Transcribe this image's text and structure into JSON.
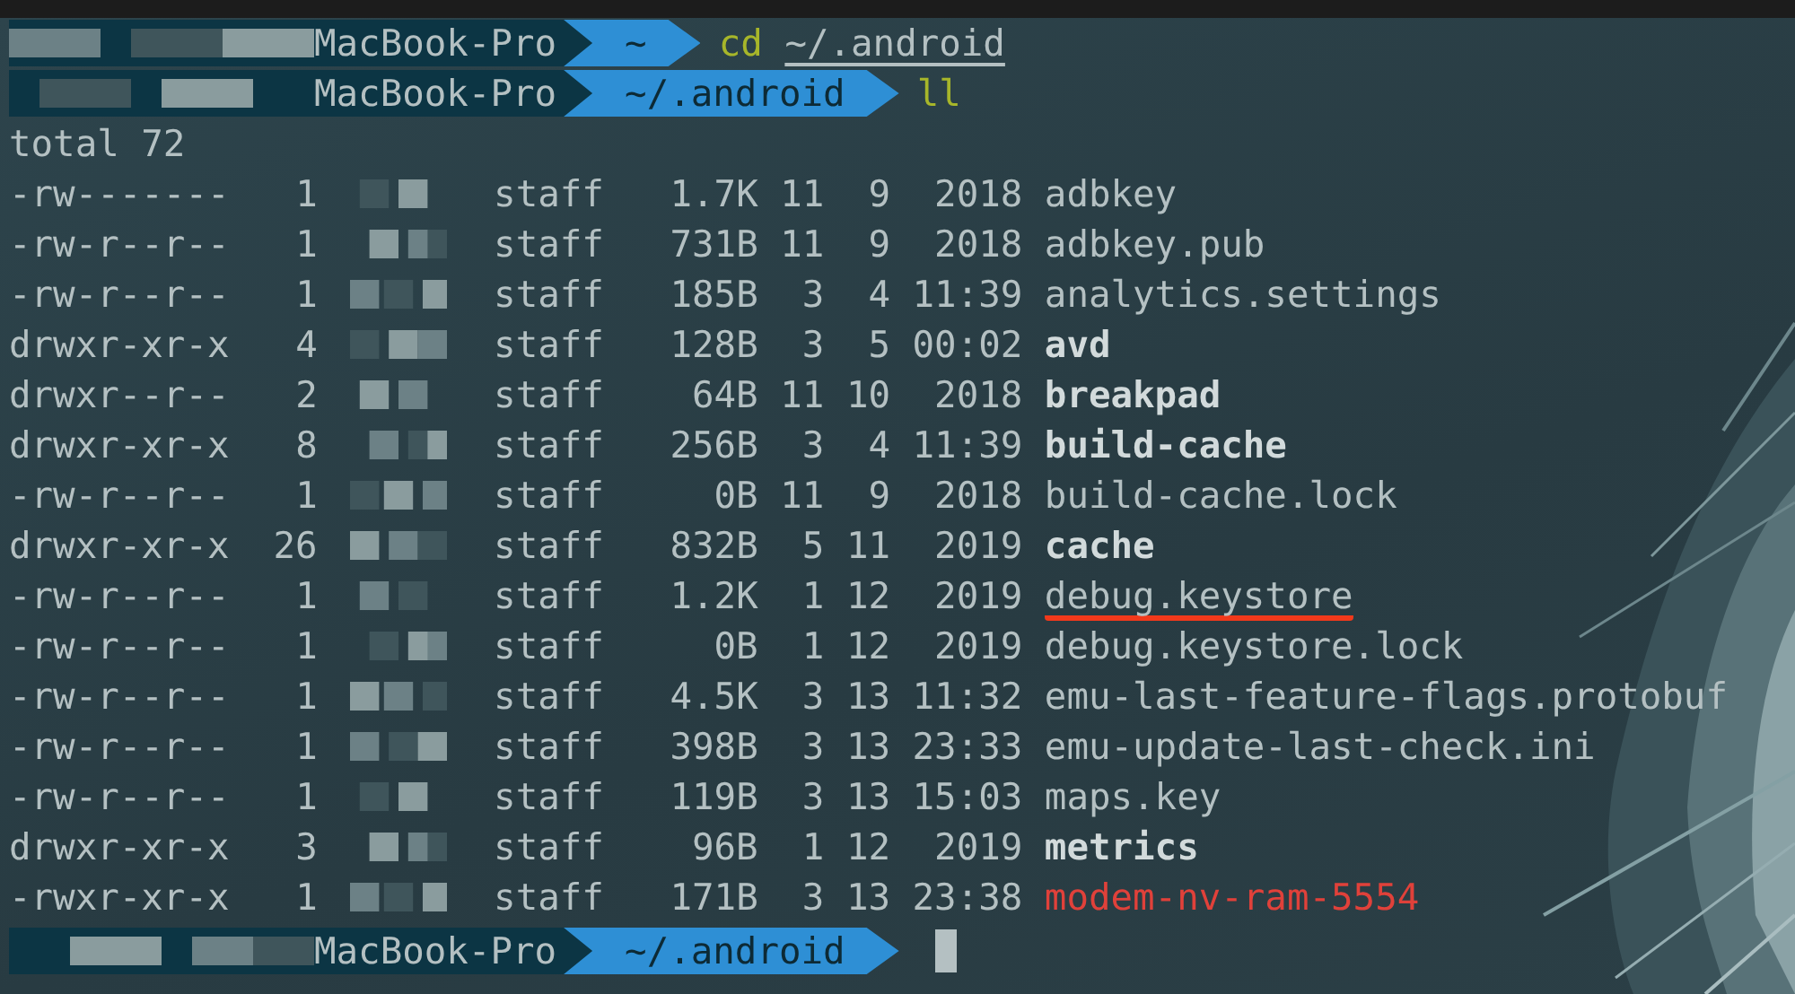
{
  "prompts": [
    {
      "host": "MacBook-Pro",
      "dir": "~",
      "command": [
        {
          "text": "cd",
          "kind": "program"
        },
        {
          "text": "~/.android",
          "kind": "path"
        }
      ]
    },
    {
      "host": "MacBook-Pro",
      "dir": "~/.android",
      "command": [
        {
          "text": "ll",
          "kind": "program"
        }
      ]
    }
  ],
  "total": "total 72",
  "rows": [
    {
      "perms": "-rw-------",
      "links": "1",
      "group": "staff",
      "size": "1.7K",
      "month": "11",
      "day": "9",
      "time": "2018",
      "name": "adbkey",
      "kind": "file",
      "underlined": false
    },
    {
      "perms": "-rw-r--r--",
      "links": "1",
      "group": "staff",
      "size": "731B",
      "month": "11",
      "day": "9",
      "time": "2018",
      "name": "adbkey.pub",
      "kind": "file",
      "underlined": false
    },
    {
      "perms": "-rw-r--r--",
      "links": "1",
      "group": "staff",
      "size": "185B",
      "month": "3",
      "day": "4",
      "time": "11:39",
      "name": "analytics.settings",
      "kind": "file",
      "underlined": false
    },
    {
      "perms": "drwxr-xr-x",
      "links": "4",
      "group": "staff",
      "size": "128B",
      "month": "3",
      "day": "5",
      "time": "00:02",
      "name": "avd",
      "kind": "dir",
      "underlined": false
    },
    {
      "perms": "drwxr--r--",
      "links": "2",
      "group": "staff",
      "size": "64B",
      "month": "11",
      "day": "10",
      "time": "2018",
      "name": "breakpad",
      "kind": "dir",
      "underlined": false
    },
    {
      "perms": "drwxr-xr-x",
      "links": "8",
      "group": "staff",
      "size": "256B",
      "month": "3",
      "day": "4",
      "time": "11:39",
      "name": "build-cache",
      "kind": "dir",
      "underlined": false
    },
    {
      "perms": "-rw-r--r--",
      "links": "1",
      "group": "staff",
      "size": "0B",
      "month": "11",
      "day": "9",
      "time": "2018",
      "name": "build-cache.lock",
      "kind": "file",
      "underlined": false
    },
    {
      "perms": "drwxr-xr-x",
      "links": "26",
      "group": "staff",
      "size": "832B",
      "month": "5",
      "day": "11",
      "time": "2019",
      "name": "cache",
      "kind": "dir",
      "underlined": false
    },
    {
      "perms": "-rw-r--r--",
      "links": "1",
      "group": "staff",
      "size": "1.2K",
      "month": "1",
      "day": "12",
      "time": "2019",
      "name": "debug.keystore",
      "kind": "file",
      "underlined": true
    },
    {
      "perms": "-rw-r--r--",
      "links": "1",
      "group": "staff",
      "size": "0B",
      "month": "1",
      "day": "12",
      "time": "2019",
      "name": "debug.keystore.lock",
      "kind": "file",
      "underlined": false
    },
    {
      "perms": "-rw-r--r--",
      "links": "1",
      "group": "staff",
      "size": "4.5K",
      "month": "3",
      "day": "13",
      "time": "11:32",
      "name": "emu-last-feature-flags.protobuf",
      "kind": "file",
      "underlined": false
    },
    {
      "perms": "-rw-r--r--",
      "links": "1",
      "group": "staff",
      "size": "398B",
      "month": "3",
      "day": "13",
      "time": "23:33",
      "name": "emu-update-last-check.ini",
      "kind": "file",
      "underlined": false
    },
    {
      "perms": "-rw-r--r--",
      "links": "1",
      "group": "staff",
      "size": "119B",
      "month": "3",
      "day": "13",
      "time": "15:03",
      "name": "maps.key",
      "kind": "file",
      "underlined": false
    },
    {
      "perms": "drwxr-xr-x",
      "links": "3",
      "group": "staff",
      "size": "96B",
      "month": "1",
      "day": "12",
      "time": "2019",
      "name": "metrics",
      "kind": "dir",
      "underlined": false
    },
    {
      "perms": "-rwxr-xr-x",
      "links": "1",
      "group": "staff",
      "size": "171B",
      "month": "3",
      "day": "13",
      "time": "23:38",
      "name": "modem-nv-ram-5554",
      "kind": "exec",
      "underlined": false
    }
  ],
  "final_prompt": {
    "host": "MacBook-Pro",
    "dir": "~/.android",
    "cursor": true
  }
}
